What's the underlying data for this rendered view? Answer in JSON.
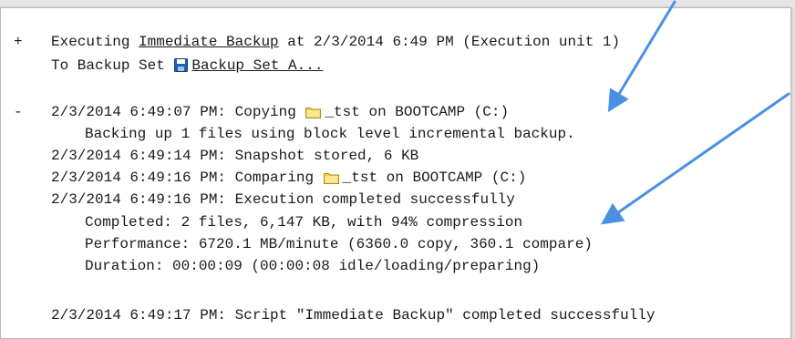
{
  "entry1": {
    "toggle": "+",
    "prefix": "Executing ",
    "job_link": "Immediate Backup",
    "suffix": " at 2/3/2014 6:49 PM (Execution unit 1)",
    "backup_set_prefix": "To Backup Set ",
    "backup_set_icon": "floppy-disk-icon",
    "backup_set_link": "Backup Set A..."
  },
  "entry2": {
    "toggle": "-",
    "copy_prefix": "2/3/2014 6:49:07 PM: Copying ",
    "copy_folder_icon": "folder-icon",
    "copy_suffix": "_tst on BOOTCAMP (C:)",
    "backing_up": "Backing up 1 files using block level incremental backup.",
    "snapshot": "2/3/2014 6:49:14 PM: Snapshot stored, 6 KB",
    "compare_prefix": "2/3/2014 6:49:16 PM: Comparing ",
    "compare_folder_icon": "folder-icon",
    "compare_suffix": "_tst on BOOTCAMP (C:)",
    "execution_completed": "2/3/2014 6:49:16 PM: Execution completed successfully",
    "completed_stats": "Completed: 2 files, 6,147 KB, with 94% compression",
    "performance": "Performance: 6720.1 MB/minute (6360.0 copy, 360.1 compare)",
    "duration": "Duration: 00:00:09 (00:00:08 idle/loading/preparing)",
    "script_completed": "2/3/2014 6:49:17 PM: Script \"Immediate Backup\" completed successfully"
  },
  "colors": {
    "arrow": "#4a90e2",
    "floppy": "#1f5fb4",
    "folder": "#f2d04e",
    "text": "#1a1a1a"
  }
}
